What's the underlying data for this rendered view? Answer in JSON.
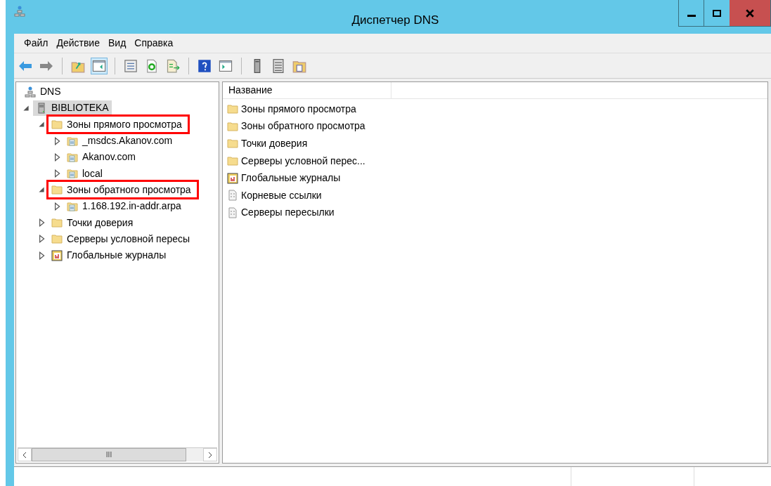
{
  "window": {
    "title": "Диспетчер DNS"
  },
  "menu": [
    "Файл",
    "Действие",
    "Вид",
    "Справка"
  ],
  "toolbar": [
    {
      "kind": "back",
      "disabled": false
    },
    {
      "kind": "forward",
      "disabled": true
    },
    {
      "kind": "sep"
    },
    {
      "kind": "up-folder"
    },
    {
      "kind": "tree-pane",
      "selected": true
    },
    {
      "kind": "sep"
    },
    {
      "kind": "properties"
    },
    {
      "kind": "refresh"
    },
    {
      "kind": "export"
    },
    {
      "kind": "sep"
    },
    {
      "kind": "help"
    },
    {
      "kind": "action-pane"
    },
    {
      "kind": "sep"
    },
    {
      "kind": "server"
    },
    {
      "kind": "list"
    },
    {
      "kind": "folders"
    }
  ],
  "tree": [
    {
      "label": "DNS",
      "kind": "dns",
      "children": [
        {
          "label": "BIBLIOTEKA",
          "kind": "server",
          "expanded": true,
          "selected": true,
          "highlighted": false,
          "children": [
            {
              "label": "Зоны прямого просмотра",
              "kind": "folder",
              "expanded": true,
              "selected": false,
              "highlighted": true,
              "children": [
                {
                  "label": "_msdcs.Akanov.com",
                  "kind": "zone",
                  "expanded": false,
                  "selected": false,
                  "highlighted": false
                },
                {
                  "label": "Akanov.com",
                  "kind": "zone",
                  "expanded": false,
                  "selected": false,
                  "highlighted": false
                },
                {
                  "label": "local",
                  "kind": "zone",
                  "expanded": false,
                  "selected": false,
                  "highlighted": false
                }
              ]
            },
            {
              "label": "Зоны обратного просмотра",
              "kind": "folder",
              "expanded": true,
              "selected": false,
              "highlighted": true,
              "children": [
                {
                  "label": "1.168.192.in-addr.arpa",
                  "kind": "zone",
                  "expanded": false,
                  "selected": false,
                  "highlighted": false
                }
              ]
            },
            {
              "label": "Точки доверия",
              "kind": "folder",
              "expanded": false,
              "selected": false,
              "highlighted": false
            },
            {
              "label": "Серверы условной пересы",
              "kind": "folder",
              "expanded": false,
              "selected": false,
              "highlighted": false
            },
            {
              "label": "Глобальные журналы",
              "kind": "log",
              "expanded": false,
              "selected": false,
              "highlighted": false
            }
          ]
        }
      ]
    }
  ],
  "list": {
    "column": "Название",
    "items": [
      {
        "label": "Зоны прямого просмотра",
        "kind": "folder"
      },
      {
        "label": "Зоны обратного просмотра",
        "kind": "folder"
      },
      {
        "label": "Точки доверия",
        "kind": "folder"
      },
      {
        "label": "Серверы условной перес...",
        "kind": "folder"
      },
      {
        "label": "Глобальные журналы",
        "kind": "log"
      },
      {
        "label": "Корневые ссылки",
        "kind": "file"
      },
      {
        "label": "Серверы пересылки",
        "kind": "file"
      }
    ]
  },
  "scrollbar": {
    "grip": "III"
  }
}
